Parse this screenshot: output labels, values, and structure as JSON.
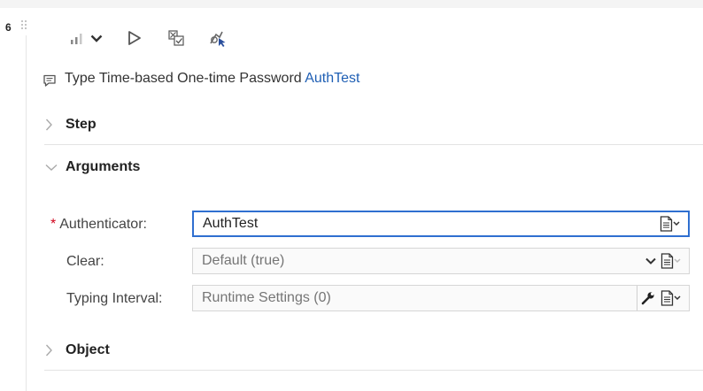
{
  "step": {
    "number": "6",
    "description_text": "Type Time-based One-time Password",
    "description_object": "AuthTest"
  },
  "toolbar": {
    "icons": [
      "signal-bars-icon",
      "chevron-down-icon",
      "play-icon",
      "checklist-icon",
      "highlight-object-icon"
    ]
  },
  "sections": {
    "step": {
      "title": "Step",
      "expanded": false
    },
    "arguments": {
      "title": "Arguments",
      "expanded": true
    },
    "object": {
      "title": "Object",
      "expanded": false
    }
  },
  "arguments": {
    "authenticator": {
      "required_mark": "*",
      "label": "Authenticator:",
      "value": "AuthTest"
    },
    "clear": {
      "label": "Clear:",
      "placeholder": "Default (true)"
    },
    "typing_interval": {
      "label": "Typing Interval:",
      "placeholder": "Runtime Settings (0)"
    }
  },
  "colors": {
    "link": "#1f5fb4",
    "required": "#d0021b",
    "focus_border": "#2f6fd0"
  }
}
